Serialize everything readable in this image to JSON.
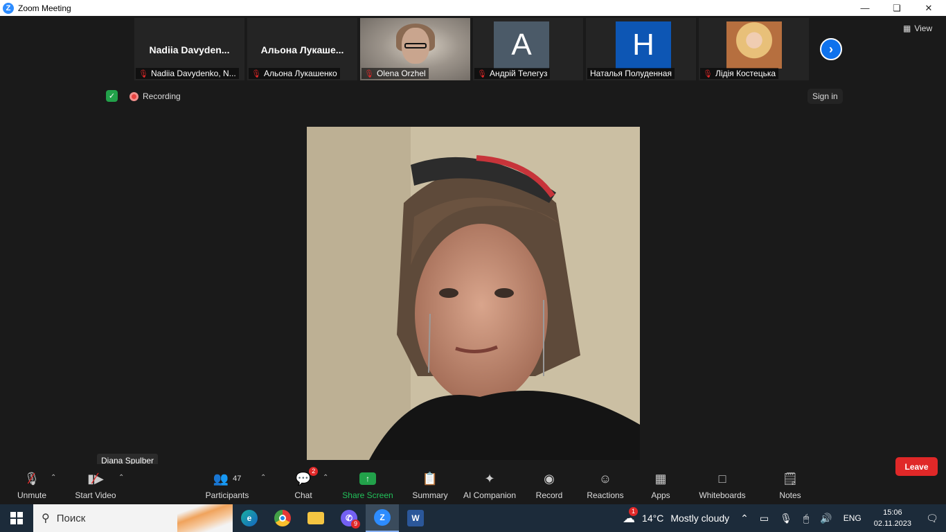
{
  "window": {
    "title": "Zoom Meeting",
    "app_icon": "Z"
  },
  "participants_strip": [
    {
      "big_name": "Nadiia  Davyden...",
      "label": "Nadiia Davydenko, N...",
      "type": "name",
      "muted": true
    },
    {
      "big_name": "Альона  Лукаше...",
      "label": "Альона Лукашенко",
      "type": "name",
      "muted": true
    },
    {
      "label": "Olena Orzhel",
      "type": "video",
      "muted": true
    },
    {
      "label": "Андрій Телегуз",
      "type": "letter",
      "letter": "A",
      "color": "#4b5a68",
      "muted": true
    },
    {
      "label": "Наталья Полуденная",
      "type": "letter",
      "letter": "H",
      "color": "#0d56b4",
      "muted": false
    },
    {
      "label": "Лідія Костецька",
      "type": "photo",
      "muted": true
    }
  ],
  "view_label": "View",
  "recording_label": "Recording",
  "signin_label": "Sign in",
  "active_speaker": "Diana Spulber",
  "toolbar": {
    "unmute": "Unmute",
    "start_video": "Start Video",
    "participants": "Participants",
    "participants_count": "47",
    "chat": "Chat",
    "chat_badge": "2",
    "share_screen": "Share Screen",
    "summary": "Summary",
    "ai_companion": "AI Companion",
    "record": "Record",
    "reactions": "Reactions",
    "apps": "Apps",
    "whiteboards": "Whiteboards",
    "notes": "Notes",
    "leave": "Leave"
  },
  "taskbar": {
    "search_placeholder": "Поиск",
    "viber_badge": "9",
    "weather_badge": "1",
    "temperature": "14°C",
    "weather": "Mostly cloudy",
    "language": "ENG",
    "time": "15:06",
    "date": "02.11.2023"
  },
  "colors": {
    "accent": "#0e72ed",
    "leave": "#e02828",
    "share": "#22a14a"
  }
}
